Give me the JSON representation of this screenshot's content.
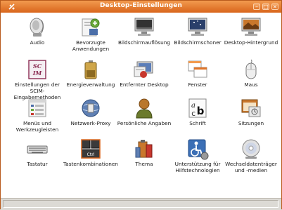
{
  "window": {
    "title": "Desktop-Einstellungen"
  },
  "items": [
    {
      "label": "Audio",
      "icon": "speaker-icon"
    },
    {
      "label": "Bevorzugte Anwendungen",
      "icon": "preferred-apps-icon"
    },
    {
      "label": "Bildschirmauflösung",
      "icon": "monitor-resolution-icon"
    },
    {
      "label": "Bildschirmschoner",
      "icon": "screensaver-icon"
    },
    {
      "label": "Desktop-Hintergrund",
      "icon": "desktop-background-icon"
    },
    {
      "label": "Einstellungen der SCIM-Eingabemethoden",
      "icon": "scim-icon"
    },
    {
      "label": "Energieverwaltung",
      "icon": "battery-icon"
    },
    {
      "label": "Entfernter Desktop",
      "icon": "remote-desktop-icon"
    },
    {
      "label": "Fenster",
      "icon": "windows-icon"
    },
    {
      "label": "Maus",
      "icon": "mouse-icon"
    },
    {
      "label": "Menüs und Werkzeugleisten",
      "icon": "menus-icon"
    },
    {
      "label": "Netzwerk-Proxy",
      "icon": "network-proxy-icon"
    },
    {
      "label": "Persönliche Angaben",
      "icon": "person-icon"
    },
    {
      "label": "Schrift",
      "icon": "font-icon"
    },
    {
      "label": "Sitzungen",
      "icon": "sessions-icon"
    },
    {
      "label": "Tastatur",
      "icon": "keyboard-icon"
    },
    {
      "label": "Tastenkombinationen",
      "icon": "keyboard-shortcuts-icon"
    },
    {
      "label": "Thema",
      "icon": "theme-icon"
    },
    {
      "label": "Unterstützung für Hilfstechnologien",
      "icon": "accessibility-icon"
    },
    {
      "label": "Wechseldatenträger und -medien",
      "icon": "removable-media-icon"
    }
  ],
  "colors": {
    "titlebar": "#e07428",
    "border": "#b85a1c",
    "background": "#ffffff"
  }
}
